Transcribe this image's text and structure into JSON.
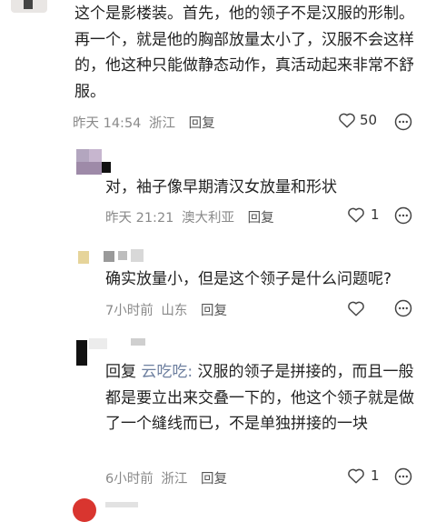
{
  "comments": [
    {
      "text": "这个是影楼装。首先，他的领子不是汉服的形制。再一个，就是他的胸部放量太小了，汉服不会这样的，他这种只能做静态动作，真活动起来非常不舒服。",
      "time": "昨天 14:54",
      "location": "浙江",
      "reply_label": "回复",
      "like_count": "50"
    },
    {
      "text": "对，袖子像早期清汉女放量和形状",
      "time": "昨天 21:21",
      "location": "澳大利亚",
      "reply_label": "回复",
      "like_count": "1"
    },
    {
      "text": "确实放量小，但是这个领子是什么问题呢?",
      "time": "7小时前",
      "location": "山东",
      "reply_label": "回复",
      "like_count": ""
    },
    {
      "reply_prefix": "回复",
      "reply_to": "云吃吃:",
      "text": "汉服的领子是拼接的，而且一般都是要立出来交叠一下的，他这个领子就是做了一个缝线而已，不是单独拼接的一块",
      "time": "6小时前",
      "location": "浙江",
      "reply_label": "回复",
      "like_count": "1"
    }
  ],
  "icons": {
    "like": "heart-outline-icon",
    "more": "more-dots-icon"
  },
  "colors": {
    "meta": "#8a8a8a",
    "reply_name": "#6d7f9f",
    "avatar_red": "#d9352f"
  }
}
